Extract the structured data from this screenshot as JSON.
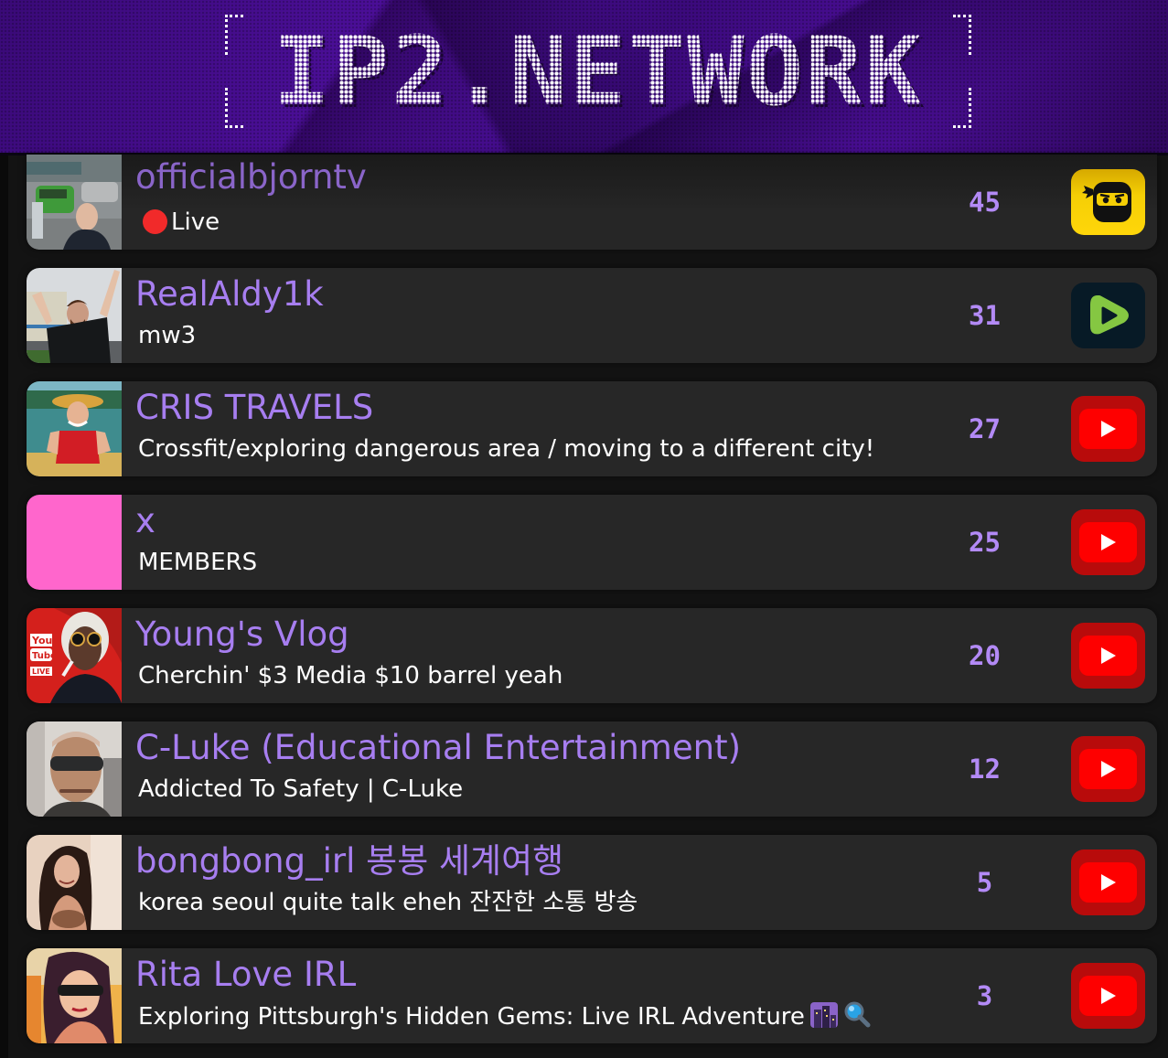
{
  "header": {
    "logo_text": "IP2.NETWORK"
  },
  "colors": {
    "accent_purple": "#a77ef0",
    "viewer_count": "#b38af6",
    "row_bg": "#272727",
    "live_red": "#f12a2a",
    "youtube_red": "#fe0000",
    "kick_yellow": "#ffd60a",
    "rumble_green": "#85c742"
  },
  "streams": [
    {
      "name": "officialbjorntv",
      "subtitle": "Live",
      "live_indicator": true,
      "viewers": "45",
      "platform": "kick-icon",
      "thumbnail": "street-selfie-thumbnail"
    },
    {
      "name": "RealAldy1k",
      "subtitle": "mw3",
      "viewers": "31",
      "platform": "rumble-icon",
      "thumbnail": "man-arms-raised-thumbnail"
    },
    {
      "name": "CRIS TRAVELS",
      "subtitle": "Crossfit/exploring dangerous area / moving to a different city!",
      "viewers": "27",
      "platform": "youtube-icon",
      "thumbnail": "boat-river-thumbnail"
    },
    {
      "name": "x",
      "subtitle": "MEMBERS",
      "viewers": "25",
      "platform": "youtube-icon",
      "thumbnail": "pink-placeholder-thumbnail"
    },
    {
      "name": "Young's Vlog",
      "subtitle": "Cherchin' $3 Media $10 barrel yeah",
      "viewers": "20",
      "platform": "youtube-icon",
      "thumbnail": "youtube-live-avatar-thumbnail"
    },
    {
      "name": "C-Luke (Educational Entertainment)",
      "subtitle": "Addicted To Safety | C-Luke",
      "viewers": "12",
      "platform": "youtube-icon",
      "thumbnail": "sunglasses-car-thumbnail"
    },
    {
      "name": "bongbong_irl 봉봉 세계여행",
      "subtitle": "korea seoul quite talk eheh 잔잔한 소통 방송",
      "viewers": "5",
      "platform": "youtube-icon",
      "thumbnail": "woman-portrait-thumbnail"
    },
    {
      "name": "Rita Love IRL",
      "subtitle": "Exploring Pittsburgh's Hidden Gems: Live IRL Adventure",
      "subtitle_emojis": [
        "cityscape-emoji",
        "magnifying-glass-emoji"
      ],
      "viewers": "3",
      "platform": "youtube-icon",
      "thumbnail": "anime-art-thumbnail"
    }
  ]
}
